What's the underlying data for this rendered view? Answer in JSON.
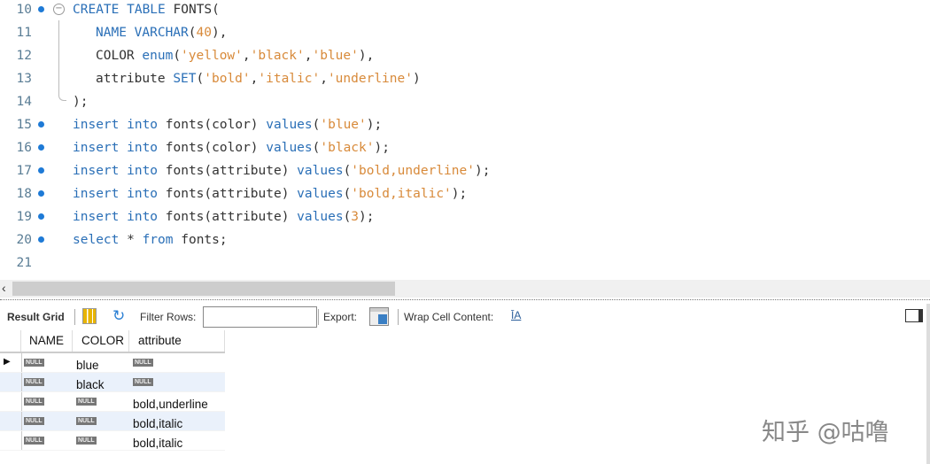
{
  "editor": {
    "lines": [
      {
        "n": "10",
        "dot": true,
        "fold": "open",
        "tokens": [
          [
            "kw",
            "CREATE TABLE "
          ],
          [
            "pl",
            "FONTS("
          ]
        ]
      },
      {
        "n": "11",
        "indent": true,
        "tokens": [
          [
            "kw",
            "NAME VARCHAR"
          ],
          [
            "pl",
            "("
          ],
          [
            "st",
            "40"
          ],
          [
            "pl",
            "),"
          ]
        ]
      },
      {
        "n": "12",
        "indent": true,
        "tokens": [
          [
            "pl",
            "COLOR "
          ],
          [
            "kw",
            "enum"
          ],
          [
            "pl",
            "("
          ],
          [
            "st",
            "'yellow'"
          ],
          [
            "pl",
            ","
          ],
          [
            "st",
            "'black'"
          ],
          [
            "pl",
            ","
          ],
          [
            "st",
            "'blue'"
          ],
          [
            "pl",
            "),"
          ]
        ]
      },
      {
        "n": "13",
        "indent": true,
        "tokens": [
          [
            "pl",
            "attribute "
          ],
          [
            "kw",
            "SET"
          ],
          [
            "pl",
            "("
          ],
          [
            "st",
            "'bold'"
          ],
          [
            "pl",
            ","
          ],
          [
            "st",
            "'italic'"
          ],
          [
            "pl",
            ","
          ],
          [
            "st",
            "'underline'"
          ],
          [
            "pl",
            ")"
          ]
        ]
      },
      {
        "n": "14",
        "tokens": [
          [
            "pl",
            ");"
          ]
        ]
      },
      {
        "n": "15",
        "dot": true,
        "tokens": [
          [
            "kw",
            "insert into "
          ],
          [
            "pl",
            "fonts(color) "
          ],
          [
            "kw",
            "values"
          ],
          [
            "pl",
            "("
          ],
          [
            "st",
            "'blue'"
          ],
          [
            "pl",
            ");"
          ]
        ]
      },
      {
        "n": "16",
        "dot": true,
        "tokens": [
          [
            "kw",
            "insert into "
          ],
          [
            "pl",
            "fonts(color) "
          ],
          [
            "kw",
            "values"
          ],
          [
            "pl",
            "("
          ],
          [
            "st",
            "'black'"
          ],
          [
            "pl",
            ");"
          ]
        ]
      },
      {
        "n": "17",
        "dot": true,
        "tokens": [
          [
            "kw",
            "insert into "
          ],
          [
            "pl",
            "fonts(attribute) "
          ],
          [
            "kw",
            "values"
          ],
          [
            "pl",
            "("
          ],
          [
            "st",
            "'bold,underline'"
          ],
          [
            "pl",
            ");"
          ]
        ]
      },
      {
        "n": "18",
        "dot": true,
        "tokens": [
          [
            "kw",
            "insert into "
          ],
          [
            "pl",
            "fonts(attribute) "
          ],
          [
            "kw",
            "values"
          ],
          [
            "pl",
            "("
          ],
          [
            "st",
            "'bold,italic'"
          ],
          [
            "pl",
            ");"
          ]
        ]
      },
      {
        "n": "19",
        "dot": true,
        "tokens": [
          [
            "kw",
            "insert into "
          ],
          [
            "pl",
            "fonts(attribute) "
          ],
          [
            "kw",
            "values"
          ],
          [
            "pl",
            "("
          ],
          [
            "st",
            "3"
          ],
          [
            "pl",
            ");"
          ]
        ]
      },
      {
        "n": "20",
        "dot": true,
        "tokens": [
          [
            "kw",
            "select "
          ],
          [
            "pl",
            "* "
          ],
          [
            "kw",
            "from "
          ],
          [
            "pl",
            "fonts;"
          ]
        ]
      },
      {
        "n": "21",
        "tokens": []
      }
    ]
  },
  "toolbar": {
    "result_grid": "Result Grid",
    "filter_label": "Filter Rows:",
    "filter_value": "",
    "export_label": "Export:",
    "wrap_label": "Wrap Cell Content:"
  },
  "grid": {
    "columns": [
      "NAME",
      "COLOR",
      "attribute"
    ],
    "null_label": "NULL",
    "rows": [
      [
        null,
        "blue",
        null
      ],
      [
        null,
        "black",
        null
      ],
      [
        null,
        null,
        "bold,underline"
      ],
      [
        null,
        null,
        "bold,italic"
      ],
      [
        null,
        null,
        "bold,italic"
      ]
    ]
  },
  "watermark": "知乎 @咕噜",
  "colors": {
    "keyword": "#2a6fb7",
    "string": "#d88a3a",
    "breakpoint": "#1e7ad6"
  }
}
